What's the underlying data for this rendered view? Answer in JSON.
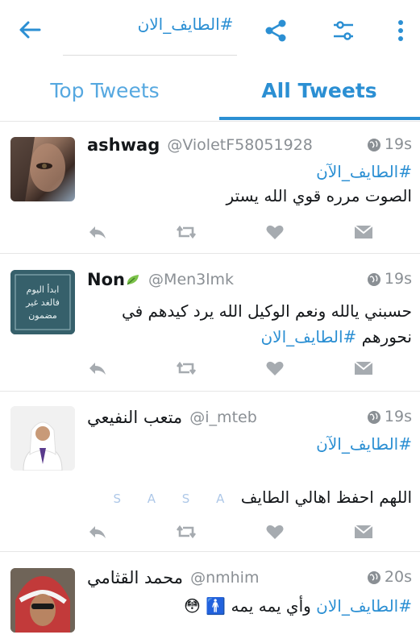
{
  "header": {
    "title": "#الطايف_الان"
  },
  "tabs": [
    {
      "label": "Top Tweets",
      "active": false
    },
    {
      "label": "All Tweets",
      "active": true
    }
  ],
  "tweets": [
    {
      "name": "ashwag",
      "handle": "@VioletF58051928",
      "time": "19s",
      "line1": "#الطايف_الآن",
      "line2": "الصوت مرره قوي الله يستر"
    },
    {
      "name": "Non",
      "handle": "@Men3lmk",
      "time": "19s",
      "line1": "حسبني يالله ونعم الوكيل الله يرد كيدهم في",
      "line2_text": "نحورهم",
      "line2_tag": "#الطايف_الان",
      "avatar_text": "ابدأ اليوم فالغد غير مضمون"
    },
    {
      "name": "متعب النفيعي",
      "handle": "@i_mteb",
      "time": "19s",
      "line1": "#الطايف_الآن",
      "line2": "اللهم احفظ اهالي الطايف",
      "decor": "S A S A"
    },
    {
      "name": "محمد القثامي",
      "handle": "@nmhim",
      "time": "20s",
      "line1_tag": "#الطايف_الان",
      "line1_text": "وأي يمه يمه 🚹 😳"
    }
  ],
  "colors": {
    "accent": "#2b8fd3",
    "muted": "#8a8f94",
    "icon": "#a6abb0"
  }
}
